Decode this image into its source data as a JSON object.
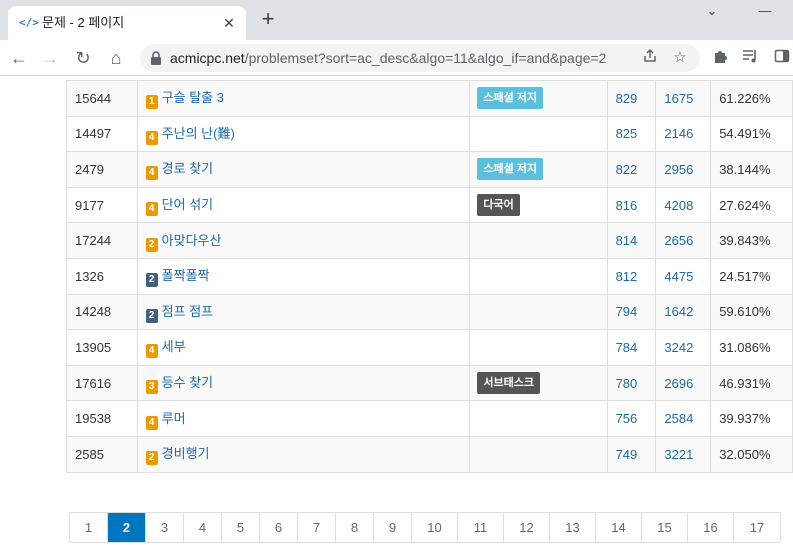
{
  "tab": {
    "favicon": "</>",
    "title": "문제 - 2 페이지",
    "close": "✕",
    "new_tab": "+"
  },
  "window": {
    "chevron": "⌄",
    "minimize": "—"
  },
  "toolbar": {
    "back": "←",
    "forward": "→",
    "reload": "↻",
    "home": "⌂",
    "url_host": "acmicpc.net",
    "url_path": "/problemset?sort=ac_desc&algo=11&algo_if=and&page=2",
    "share_icon": "share-icon",
    "star_icon": "star-icon",
    "extensions_icon": "puzzle-icon",
    "media_icon": "media-icon",
    "sidepanel_icon": "sidepanel-icon"
  },
  "colors": {
    "link": "#1b6aa5",
    "tier_gold": "#ec9a00",
    "tier_silver": "#435f7a",
    "badge_special": "#5bc0de",
    "badge_dark": "#555555",
    "page_active": "#0076c0"
  },
  "problems": [
    {
      "id": "15644",
      "tier": "1",
      "tier_color": "gold",
      "title": "구슬 탈출 3",
      "tag": "스페셜 저지",
      "tag_style": "special",
      "solved": "829",
      "submit": "1675",
      "rate": "61.226%"
    },
    {
      "id": "14497",
      "tier": "4",
      "tier_color": "gold",
      "title": "주난의 난(難)",
      "tag": "",
      "tag_style": "",
      "solved": "825",
      "submit": "2146",
      "rate": "54.491%"
    },
    {
      "id": "2479",
      "tier": "4",
      "tier_color": "gold",
      "title": "경로 찾기",
      "tag": "스페셜 저지",
      "tag_style": "special",
      "solved": "822",
      "submit": "2956",
      "rate": "38.144%"
    },
    {
      "id": "9177",
      "tier": "4",
      "tier_color": "gold",
      "title": "단어 섞기",
      "tag": "다국어",
      "tag_style": "dark",
      "solved": "816",
      "submit": "4208",
      "rate": "27.624%"
    },
    {
      "id": "17244",
      "tier": "2",
      "tier_color": "gold",
      "title": "아맞다우산",
      "tag": "",
      "tag_style": "",
      "solved": "814",
      "submit": "2656",
      "rate": "39.843%"
    },
    {
      "id": "1326",
      "tier": "2",
      "tier_color": "silver",
      "title": "폴짝폴짝",
      "tag": "",
      "tag_style": "",
      "solved": "812",
      "submit": "4475",
      "rate": "24.517%"
    },
    {
      "id": "14248",
      "tier": "2",
      "tier_color": "silver",
      "title": "점프 점프",
      "tag": "",
      "tag_style": "",
      "solved": "794",
      "submit": "1642",
      "rate": "59.610%"
    },
    {
      "id": "13905",
      "tier": "4",
      "tier_color": "gold",
      "title": "세부",
      "tag": "",
      "tag_style": "",
      "solved": "784",
      "submit": "3242",
      "rate": "31.086%"
    },
    {
      "id": "17616",
      "tier": "3",
      "tier_color": "gold",
      "title": "등수 찾기",
      "tag": "서브태스크",
      "tag_style": "dark",
      "solved": "780",
      "submit": "2696",
      "rate": "46.931%"
    },
    {
      "id": "19538",
      "tier": "4",
      "tier_color": "gold",
      "title": "루머",
      "tag": "",
      "tag_style": "",
      "solved": "756",
      "submit": "2584",
      "rate": "39.937%"
    },
    {
      "id": "2585",
      "tier": "2",
      "tier_color": "gold",
      "title": "경비행기",
      "tag": "",
      "tag_style": "",
      "solved": "749",
      "submit": "3221",
      "rate": "32.050%"
    }
  ],
  "pagination": {
    "active": "2",
    "pages": [
      "1",
      "2",
      "3",
      "4",
      "5",
      "6",
      "7",
      "8",
      "9",
      "10",
      "11",
      "12",
      "13",
      "14",
      "15",
      "16",
      "17"
    ]
  }
}
